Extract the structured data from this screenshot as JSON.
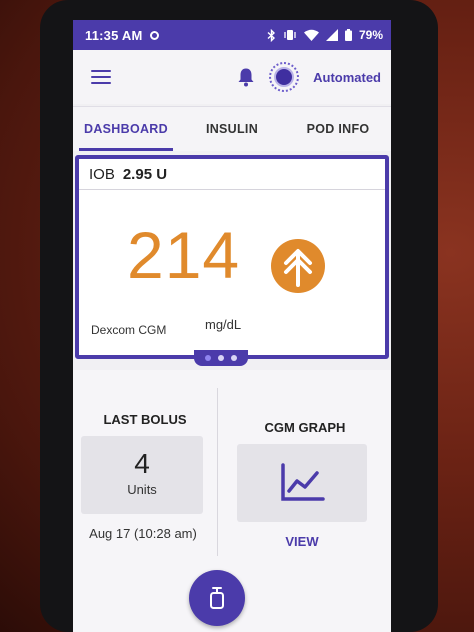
{
  "status_bar": {
    "time": "11:35 AM",
    "battery": "79%"
  },
  "header": {
    "mode": "Automated"
  },
  "tabs": [
    {
      "label": "DASHBOARD",
      "active": true
    },
    {
      "label": "INSULIN",
      "active": false
    },
    {
      "label": "POD INFO",
      "active": false
    }
  ],
  "cgm_card": {
    "iob_label": "IOB",
    "iob_value": "2.95 U",
    "glucose": "214",
    "unit": "mg/dL",
    "source": "Dexcom CGM",
    "trend": "double-up-arrow-icon",
    "pager": {
      "pages": 3,
      "current": 1
    }
  },
  "last_bolus": {
    "title": "LAST BOLUS",
    "amount": "4",
    "unit": "Units",
    "datetime": "Aug 17 (10:28 am)"
  },
  "cgm_graph": {
    "title": "CGM GRAPH",
    "link": "VIEW"
  },
  "colors": {
    "primary": "#4b3baa",
    "glucose": "#e08a2c"
  }
}
